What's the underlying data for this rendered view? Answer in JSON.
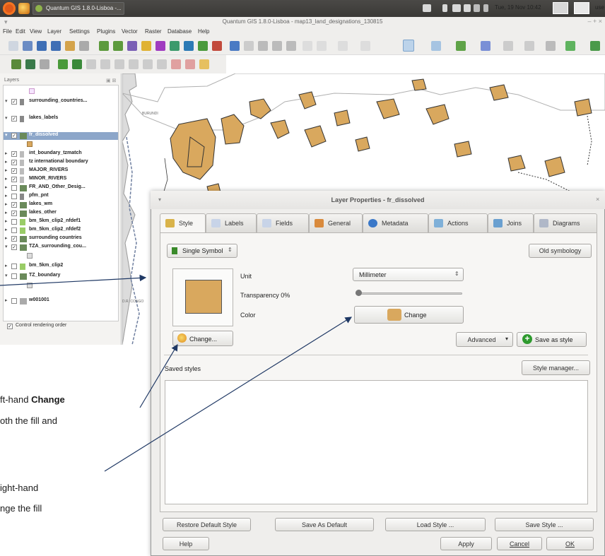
{
  "top_panel": {
    "task_label": "Quantum GIS 1.8.0-Lisboa -...",
    "clock": "Tue, 19 Nov 10:42",
    "user": "use"
  },
  "qgis_window": {
    "title": "Quantum GIS 1.8.0-Lisboa - map13_land_designations_130815",
    "menus": [
      "File",
      "Edit",
      "View",
      "Layer",
      "Settings",
      "Plugins",
      "Vector",
      "Raster",
      "Database",
      "Help"
    ]
  },
  "layers_panel": {
    "title": "Layers",
    "layers": [
      {
        "name": "surrounding_countries...",
        "checked": true,
        "expanded": true
      },
      {
        "name": "lakes_labels",
        "checked": true,
        "expanded": true
      },
      {
        "name": "fr_dissolved",
        "checked": true,
        "expanded": true,
        "selected": true
      },
      {
        "name": "int_boundary_tzmatch",
        "checked": true
      },
      {
        "name": "tz international boundary",
        "checked": true
      },
      {
        "name": "MAJOR_RIVERS",
        "checked": true
      },
      {
        "name": "MINOR_RIVERS",
        "checked": true
      },
      {
        "name": "FR_AND_Other_Desig...",
        "checked": false
      },
      {
        "name": "pfm_pnt",
        "checked": false
      },
      {
        "name": "lakes_wm",
        "checked": true
      },
      {
        "name": "lakes_other",
        "checked": true
      },
      {
        "name": "bm_5km_clip2_nfdef1",
        "checked": false
      },
      {
        "name": "bm_5km_clip2_nfdef2",
        "checked": false
      },
      {
        "name": "surrounding countries",
        "checked": true
      },
      {
        "name": "TZA_surrounding_cou...",
        "checked": true,
        "expanded": true
      },
      {
        "name": "bm_5km_clip2",
        "checked": false
      },
      {
        "name": "TZ_boundary",
        "checked": false,
        "expanded": true
      },
      {
        "name": "w001001",
        "checked": false
      }
    ],
    "control_rendering_order": "Control rendering order"
  },
  "map": {
    "labels": [
      "BURUNDI",
      "D.R. CONGO"
    ],
    "fill_color": "#d9a85e"
  },
  "dialog": {
    "title": "Layer Properties - fr_dissolved",
    "tabs": [
      "Style",
      "Labels",
      "Fields",
      "General",
      "Metadata",
      "Actions",
      "Joins",
      "Diagrams"
    ],
    "active_tab": "Style",
    "symbol_type": "Single Symbol",
    "old_symbology": "Old symbology",
    "unit_label": "Unit",
    "unit_value": "Millimeter",
    "transparency_label": "Transparency 0%",
    "transparency_value": 0,
    "color_label": "Color",
    "color_change": "Change",
    "symbol_change": "Change...",
    "advanced": "Advanced",
    "save_as_style": "Save as style",
    "saved_styles": "Saved styles",
    "style_manager": "Style manager...",
    "buttons": {
      "restore_default": "Restore Default Style",
      "save_as_default": "Save As Default",
      "load_style": "Load Style ...",
      "save_style": "Save Style ...",
      "help": "Help",
      "apply": "Apply",
      "cancel": "Cancel",
      "ok": "OK"
    },
    "symbol_color": "#d9a85e"
  },
  "annotations": {
    "left_line1_pre": "ft-hand ",
    "left_line1_bold": "Change",
    "left_line2": "oth the fill and",
    "right_line1": "ight-hand",
    "right_line2": "nge the fill"
  }
}
